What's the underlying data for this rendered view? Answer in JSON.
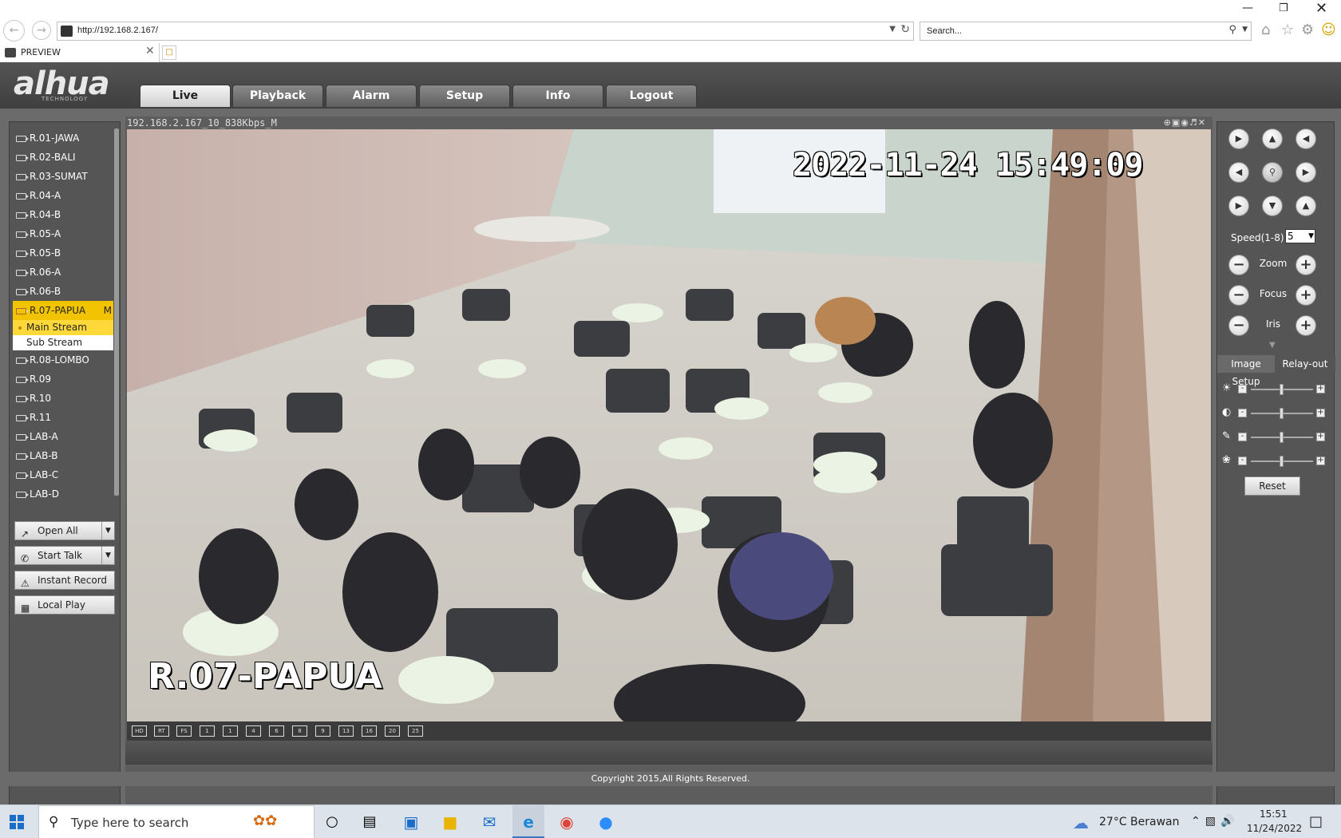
{
  "browser": {
    "url": "http://192.168.2.167/",
    "search_placeholder": "Search...",
    "tab_title": "PREVIEW"
  },
  "app": {
    "logo": "alhua",
    "logo_sub": "TECHNOLOGY",
    "tabs": [
      {
        "label": "Live",
        "active": true
      },
      {
        "label": "Playback"
      },
      {
        "label": "Alarm"
      },
      {
        "label": "Setup"
      },
      {
        "label": "Info"
      },
      {
        "label": "Logout"
      }
    ],
    "channels": [
      {
        "label": "R.01-JAWA"
      },
      {
        "label": "R.02-BALI"
      },
      {
        "label": "R.03-SUMAT"
      },
      {
        "label": "R.04-A"
      },
      {
        "label": "R.04-B"
      },
      {
        "label": "R.05-A"
      },
      {
        "label": "R.05-B"
      },
      {
        "label": "R.06-A"
      },
      {
        "label": "R.06-B"
      },
      {
        "label": "R.07-PAPUA",
        "active": true,
        "suffix": "M"
      },
      {
        "label": "R.08-LOMBO"
      },
      {
        "label": "R.09"
      },
      {
        "label": "R.10"
      },
      {
        "label": "R.11"
      },
      {
        "label": "LAB-A"
      },
      {
        "label": "LAB-B"
      },
      {
        "label": "LAB-C"
      },
      {
        "label": "LAB-D"
      }
    ],
    "streams": {
      "main": "Main Stream",
      "sub": "Sub Stream"
    },
    "side_buttons": {
      "open_all": "Open All",
      "start_talk": "Start Talk",
      "instant_record": "Instant Record",
      "local_play": "Local Play"
    },
    "video": {
      "info": "192.168.2.167_10_838Kbps_M",
      "timestamp": "2022-11-24 15:49:09",
      "camera_name": "R.07-PAPUA"
    },
    "video_toolbar": [
      "HD",
      "RT",
      "FS",
      "1",
      "1",
      "4",
      "6",
      "8",
      "9",
      "13",
      "16",
      "20",
      "25"
    ],
    "ptz": {
      "speed_label": "Speed(1-8):",
      "speed_value": "5",
      "zoom_label": "Zoom",
      "focus_label": "Focus",
      "iris_label": "Iris"
    },
    "image_tabs": {
      "image_setup": "Image Setup",
      "relay_out": "Relay-out"
    },
    "sliders": [
      {
        "name": "brightness",
        "value": 0.5
      },
      {
        "name": "contrast",
        "value": 0.5
      },
      {
        "name": "saturation",
        "value": 0.5
      },
      {
        "name": "hue",
        "value": 0.5
      }
    ],
    "reset_label": "Reset",
    "copyright": "Copyright 2015,All Rights Reserved."
  },
  "taskbar": {
    "search_placeholder": "Type here to search",
    "weather": "27°C  Berawan",
    "time": "15:51",
    "date": "11/24/2022"
  }
}
